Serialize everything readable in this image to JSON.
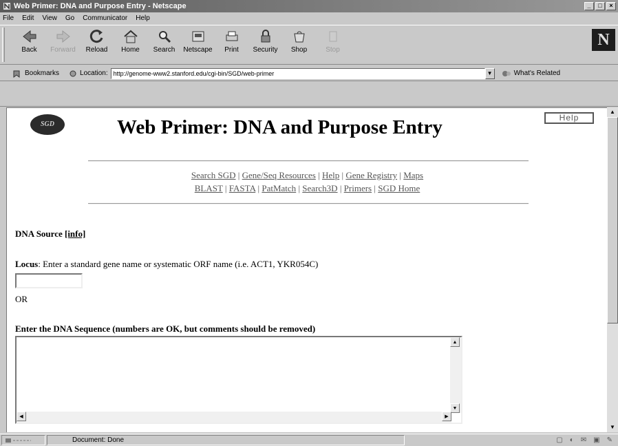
{
  "window": {
    "title": "Web Primer: DNA and Purpose Entry - Netscape"
  },
  "menu": [
    "File",
    "Edit",
    "View",
    "Go",
    "Communicator",
    "Help"
  ],
  "toolbar": {
    "buttons": [
      {
        "label": "Back",
        "icon": "back-icon",
        "enabled": true
      },
      {
        "label": "Forward",
        "icon": "forward-icon",
        "enabled": false
      },
      {
        "label": "Reload",
        "icon": "reload-icon",
        "enabled": true
      },
      {
        "label": "Home",
        "icon": "home-icon",
        "enabled": true
      },
      {
        "label": "Search",
        "icon": "search-icon",
        "enabled": true
      },
      {
        "label": "Netscape",
        "icon": "netscape-icon",
        "enabled": true
      },
      {
        "label": "Print",
        "icon": "print-icon",
        "enabled": true
      },
      {
        "label": "Security",
        "icon": "security-icon",
        "enabled": true
      },
      {
        "label": "Shop",
        "icon": "shop-icon",
        "enabled": true
      },
      {
        "label": "Stop",
        "icon": "stop-icon",
        "enabled": false
      }
    ],
    "logo": "N"
  },
  "location": {
    "bookmarks_label": "Bookmarks",
    "location_label": "Location:",
    "url": "http://genome-www2.stanford.edu/cgi-bin/SGD/web-primer",
    "related_label": "What's Related"
  },
  "page": {
    "logo_text": "SGD",
    "title": "Web Primer: DNA and Purpose Entry",
    "help_label": "Help",
    "links_row1": [
      "Search SGD",
      "Gene/Seq Resources",
      "Help",
      "Gene Registry",
      "Maps"
    ],
    "links_row2": [
      "BLAST",
      "FASTA",
      "PatMatch",
      "Search3D",
      "Primers",
      "SGD Home"
    ],
    "dna_source": "DNA Source",
    "info_link": "[info]",
    "locus_label": "Locus",
    "locus_text": ": Enter a standard gene name or systematic ORF name (i.e. ACT1, YKR054C)",
    "locus_value": "",
    "or_text": "OR",
    "sequence_label": "Enter the DNA Sequence (numbers are OK, but comments should be removed)",
    "sequence_value": ""
  },
  "status": {
    "text": "Document: Done"
  }
}
